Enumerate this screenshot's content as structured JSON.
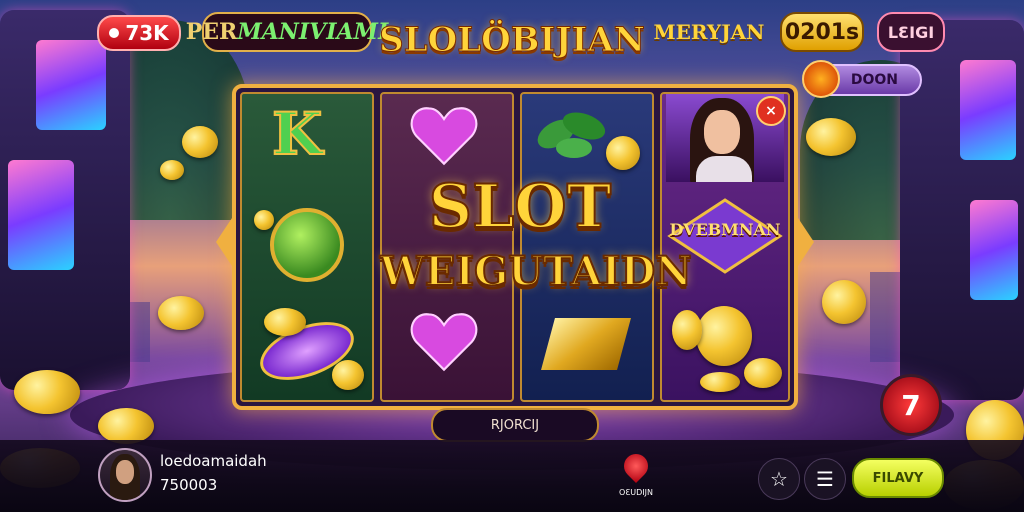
{
  "top_bar": {
    "live_count": "73K",
    "badge_left_a": "PER",
    "badge_left_b": "MANIVIAMI",
    "game_title": "SLOLÖBIJIAN",
    "badge_right": "MERYJAN",
    "balance_badge": "0201s",
    "badge_x": "LƐIGI",
    "doon_label": "DOON"
  },
  "reels": {
    "center_title": "SLOT",
    "center_subtitle": "WEIGUTAIDN",
    "reel4_emblem_text": "DVEBMNAN",
    "k_symbol": "K",
    "portrait_close": "×"
  },
  "controls": {
    "spin_label": "RJORCIJ",
    "spin_button_glyph": "7"
  },
  "player": {
    "name": "loedoamaidah",
    "balance": "750003",
    "pin_label": "OƐUDIJN",
    "play_button": "FILAVY"
  },
  "colors": {
    "gold": "#ffd43a",
    "accent_red": "#e03020",
    "play_green": "#d8f000",
    "purple": "#6a2a8a"
  },
  "icons": [
    "star-icon",
    "menu-icon",
    "map-pin-icon",
    "close-icon",
    "coin-icon"
  ]
}
